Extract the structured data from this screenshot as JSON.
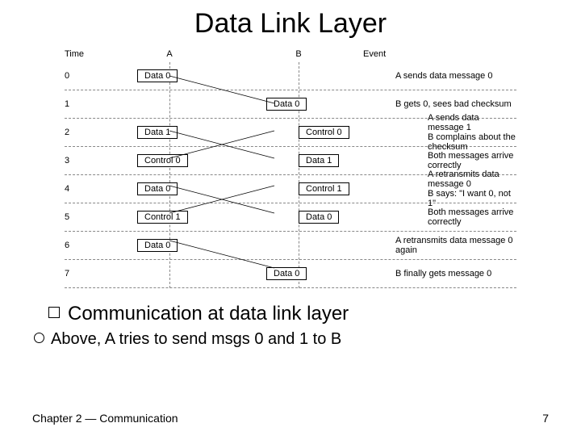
{
  "title": "Data Link Layer",
  "diagram": {
    "headers": {
      "time": "Time",
      "a": "A",
      "b": "B",
      "event": "Event"
    },
    "rows": [
      {
        "time": "0",
        "a_msg": "Data 0",
        "b_msg": "",
        "event": "A sends data message 0"
      },
      {
        "time": "1",
        "a_msg": "",
        "b_msg": "Data 0",
        "event": "B gets 0, sees bad checksum"
      },
      {
        "time": "2",
        "a_msg": "Data 1",
        "b_msg": "Control 0",
        "event": "A sends data message 1\nB complains about the checksum"
      },
      {
        "time": "3",
        "a_msg": "Control 0",
        "b_msg": "Data 1",
        "event": "Both messages arrive correctly"
      },
      {
        "time": "4",
        "a_msg": "Data 0",
        "b_msg": "Control 1",
        "event": "A retransmits data message 0\nB says: \"I want 0, not 1\""
      },
      {
        "time": "5",
        "a_msg": "Control 1",
        "b_msg": "Data 0",
        "event": "Both messages arrive correctly"
      },
      {
        "time": "6",
        "a_msg": "Data 0",
        "b_msg": "",
        "event": "A retransmits data message 0 again"
      },
      {
        "time": "7",
        "a_msg": "",
        "b_msg": "Data 0",
        "event": "B finally gets message 0"
      }
    ]
  },
  "bullet_main": "Communication at data link layer",
  "bullet_sub": "Above, A tries to send msgs 0 and 1 to B",
  "footer": {
    "left": "Chapter 2 — Communication",
    "right": "7"
  }
}
